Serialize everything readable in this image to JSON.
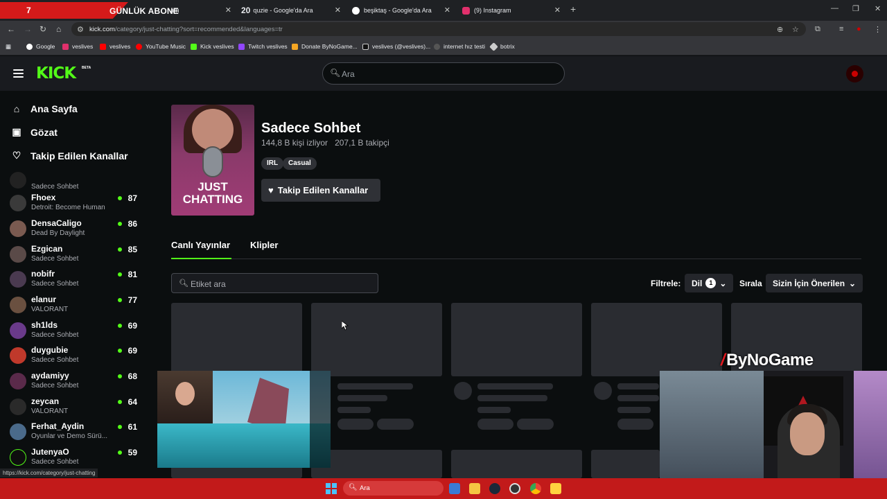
{
  "browser": {
    "banner_num": "7",
    "banner_text": "GÜNLÜK ABONE",
    "tabs": [
      {
        "title": "am"
      },
      {
        "badge": "20",
        "title": "quzie - Google'da Ara"
      },
      {
        "title": "beşiktaş - Google'da Ara"
      },
      {
        "title": "(9) Instagram"
      }
    ],
    "url_domain": "kick.com",
    "url_path": "/category/just-chatting?sort=recommended&languages=tr",
    "bookmarks": [
      "Google",
      "veslives",
      "veslives",
      "YouTube Music",
      "Kick veslives",
      "Twitch veslives",
      "Donate ByNoGame...",
      "veslives (@veslives)...",
      "internet hız testi",
      "botrix"
    ],
    "status_url": "https://kick.com/category/just-chatting"
  },
  "kick": {
    "logo": "KICK",
    "beta": "BETA",
    "search_placeholder": "Ara"
  },
  "sidebar": {
    "nav": [
      {
        "label": "Ana Sayfa"
      },
      {
        "label": "Gözat"
      },
      {
        "label": "Takip Edilen Kanallar"
      }
    ],
    "channels": [
      {
        "name": "",
        "category": "Sadece Sohbet",
        "viewers": ""
      },
      {
        "name": "Fhoex",
        "category": "Detroit: Become Human",
        "viewers": "87"
      },
      {
        "name": "DensaCaligo",
        "category": "Dead By Daylight",
        "viewers": "86"
      },
      {
        "name": "Ezgican",
        "category": "Sadece Sohbet",
        "viewers": "85"
      },
      {
        "name": "nobifr",
        "category": "Sadece Sohbet",
        "viewers": "81"
      },
      {
        "name": "elanur",
        "category": "VALORANT",
        "viewers": "77"
      },
      {
        "name": "sh1lds",
        "category": "Sadece Sohbet",
        "viewers": "69"
      },
      {
        "name": "duygubie",
        "category": "Sadece Sohbet",
        "viewers": "69"
      },
      {
        "name": "aydamiyy",
        "category": "Sadece Sohbet",
        "viewers": "68"
      },
      {
        "name": "zeycan",
        "category": "VALORANT",
        "viewers": "64"
      },
      {
        "name": "Ferhat_Aydin",
        "category": "Oyunlar ve Demo Sürü...",
        "viewers": "61"
      },
      {
        "name": "JutenyaO",
        "category": "Sadece Sohbet",
        "viewers": "59"
      }
    ]
  },
  "category": {
    "cover_line1": "JUST",
    "cover_line2": "CHATTING",
    "title": "Sadece Sohbet",
    "viewers": "144,8 B kişi izliyor",
    "followers": "207,1 B takipçi",
    "tags": [
      "IRL",
      "Casual"
    ],
    "follow_label": "Takip Edilen Kanallar",
    "tabs": [
      "Canlı Yayınlar",
      "Klipler"
    ],
    "tag_search_placeholder": "Etiket ara",
    "filter_label": "Filtrele:",
    "lang_label": "Dil",
    "lang_count": "1",
    "sort_label": "Sırala",
    "sort_value": "Sizin İçin Önerilen"
  },
  "overlay": {
    "brand": "ByNoGame"
  },
  "taskbar": {
    "search_placeholder": "Ara"
  }
}
